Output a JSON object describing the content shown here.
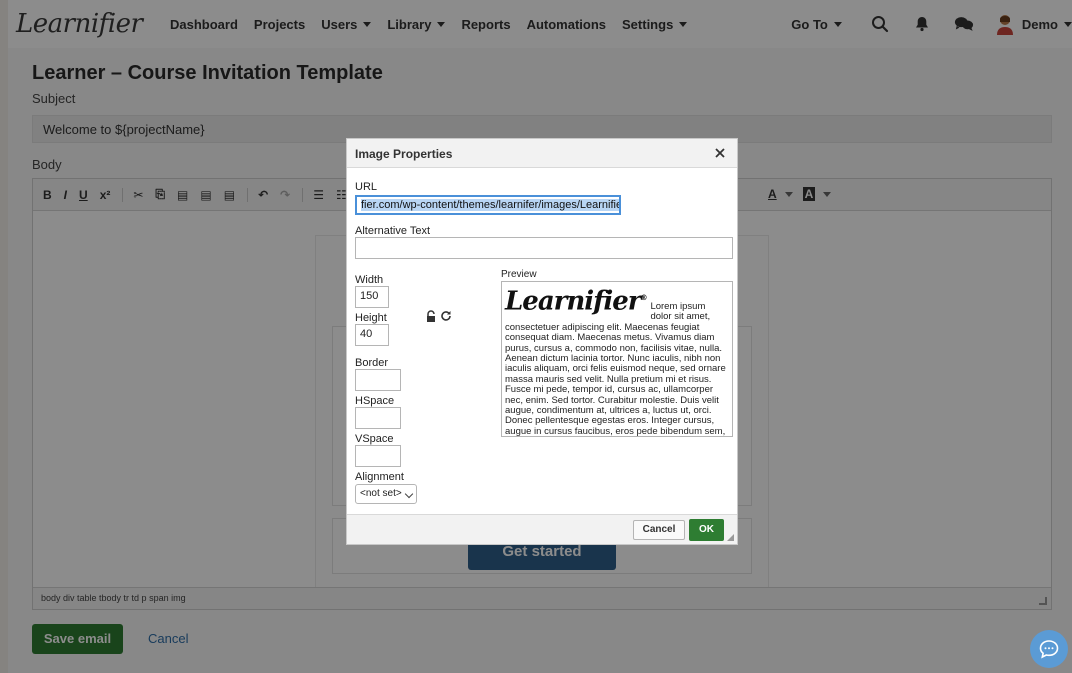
{
  "nav": {
    "logo": "Learnifier",
    "items": [
      {
        "label": "Dashboard",
        "dropdown": false
      },
      {
        "label": "Projects",
        "dropdown": false
      },
      {
        "label": "Users",
        "dropdown": true
      },
      {
        "label": "Library",
        "dropdown": true
      },
      {
        "label": "Reports",
        "dropdown": false
      },
      {
        "label": "Automations",
        "dropdown": false
      },
      {
        "label": "Settings",
        "dropdown": true
      }
    ],
    "goto": "Go To",
    "user": "Demo"
  },
  "page": {
    "title": "Learner – Course Invitation Template",
    "subject_label": "Subject",
    "subject_value": "Welcome to ${projectName}",
    "body_label": "Body",
    "toolbar": {
      "buttons": [
        "B",
        "I",
        "U",
        "x²"
      ],
      "font_color": "A",
      "bg_color": "A"
    },
    "cta_label": "Get started",
    "element_path": "body  div  table  tbody  tr  td  p  span  img",
    "save_label": "Save email",
    "cancel_label": "Cancel"
  },
  "dialog": {
    "title": "Image Properties",
    "url_label": "URL",
    "url_value": "fier.com/wp-content/themes/learnifer/images/Learnifier-logo.png",
    "alt_label": "Alternative Text",
    "alt_value": "",
    "width_label": "Width",
    "width_value": "150",
    "height_label": "Height",
    "height_value": "40",
    "border_label": "Border",
    "hspace_label": "HSpace",
    "vspace_label": "VSpace",
    "alignment_label": "Alignment",
    "alignment_value": "<not set>",
    "preview_label": "Preview",
    "preview_logo": "Learnifier",
    "preview_logo_mark": "®",
    "preview_text": "Lorem ipsum dolor sit amet, consectetuer adipiscing elit. Maecenas feugiat consequat diam. Maecenas metus. Vivamus diam purus, cursus a, commodo non, facilisis vitae, nulla. Aenean dictum lacinia tortor. Nunc iaculis, nibh non iaculis aliquam, orci felis euismod neque, sed ornare massa mauris sed velit. Nulla pretium mi et risus. Fusce mi pede, tempor id, cursus ac, ullamcorper nec, enim. Sed tortor. Curabitur molestie. Duis velit augue, condimentum at, ultrices a, luctus ut, orci. Donec pellentesque egestas eros. Integer cursus, augue in cursus faucibus, eros pede bibendum sem, in tempus tellus justo quis ligula. Etiam eget tortor. Vestibulum",
    "cancel_label": "Cancel",
    "ok_label": "OK"
  },
  "colors": {
    "primary_green": "#2e7d32",
    "link_blue": "#2f6ea8",
    "cta_blue": "#2e5f8a",
    "chat_blue": "#5b9bd5"
  }
}
